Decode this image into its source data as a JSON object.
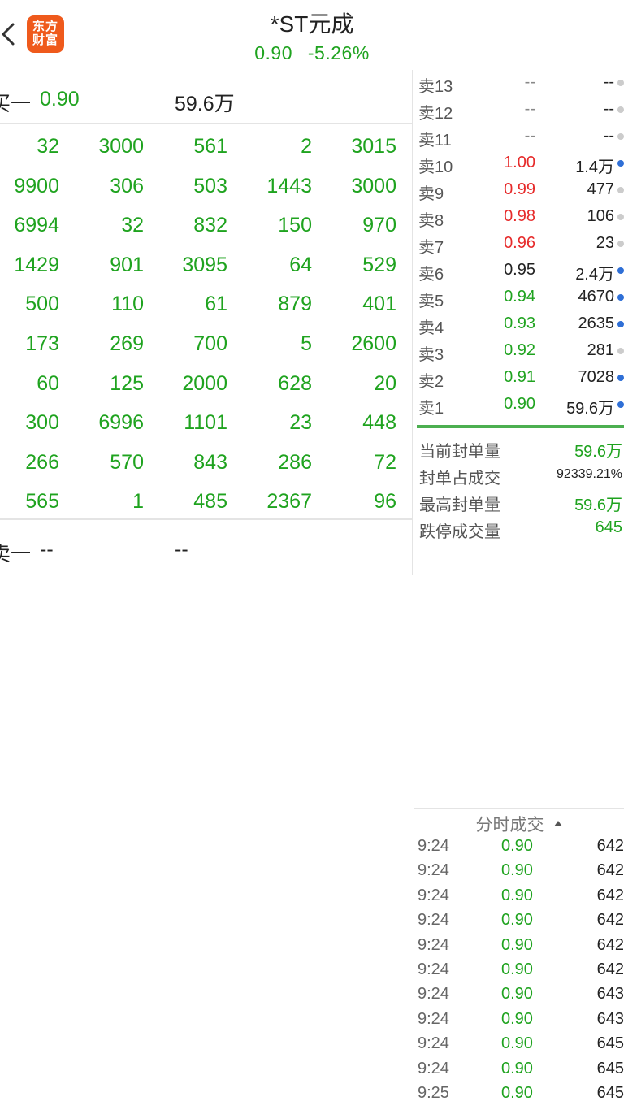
{
  "header": {
    "logo_text_line1": "东方",
    "logo_text_line2": "财富",
    "title": "*ST元成",
    "price": "0.90",
    "change": "-5.26%"
  },
  "left_panel": {
    "buy1": {
      "label": "买一",
      "price": "0.90",
      "volume": "59.6万"
    },
    "queue": [
      [
        "32",
        "3000",
        "561",
        "2",
        "3015"
      ],
      [
        "9900",
        "306",
        "503",
        "1443",
        "3000"
      ],
      [
        "6994",
        "32",
        "832",
        "150",
        "970"
      ],
      [
        "1429",
        "901",
        "3095",
        "64",
        "529"
      ],
      [
        "500",
        "110",
        "61",
        "879",
        "401"
      ],
      [
        "173",
        "269",
        "700",
        "5",
        "2600"
      ],
      [
        "60",
        "125",
        "2000",
        "628",
        "20"
      ],
      [
        "300",
        "6996",
        "1101",
        "23",
        "448"
      ],
      [
        "266",
        "570",
        "843",
        "286",
        "72"
      ],
      [
        "565",
        "1",
        "485",
        "2367",
        "96"
      ]
    ],
    "sell1": {
      "label": "卖一",
      "price": "--",
      "volume": "--"
    }
  },
  "order_book": [
    {
      "label": "卖13",
      "price": "--",
      "volume": "--",
      "price_color": "#888888",
      "dot": "#cccccc"
    },
    {
      "label": "卖12",
      "price": "--",
      "volume": "--",
      "price_color": "#888888",
      "dot": "#cccccc"
    },
    {
      "label": "卖11",
      "price": "--",
      "volume": "--",
      "price_color": "#888888",
      "dot": "#cccccc"
    },
    {
      "label": "卖10",
      "price": "1.00",
      "volume": "1.4万",
      "price_color": "#e62a2a",
      "dot": "#2f6fd6"
    },
    {
      "label": "卖9",
      "price": "0.99",
      "volume": "477",
      "price_color": "#e62a2a",
      "dot": "#cccccc"
    },
    {
      "label": "卖8",
      "price": "0.98",
      "volume": "106",
      "price_color": "#e62a2a",
      "dot": "#cccccc"
    },
    {
      "label": "卖7",
      "price": "0.96",
      "volume": "23",
      "price_color": "#e62a2a",
      "dot": "#cccccc"
    },
    {
      "label": "卖6",
      "price": "0.95",
      "volume": "2.4万",
      "price_color": "#222222",
      "dot": "#2f6fd6"
    },
    {
      "label": "卖5",
      "price": "0.94",
      "volume": "4670",
      "price_color": "#1fa31f",
      "dot": "#2f6fd6"
    },
    {
      "label": "卖4",
      "price": "0.93",
      "volume": "2635",
      "price_color": "#1fa31f",
      "dot": "#2f6fd6"
    },
    {
      "label": "卖3",
      "price": "0.92",
      "volume": "281",
      "price_color": "#1fa31f",
      "dot": "#cccccc"
    },
    {
      "label": "卖2",
      "price": "0.91",
      "volume": "7028",
      "price_color": "#1fa31f",
      "dot": "#2f6fd6"
    },
    {
      "label": "卖1",
      "price": "0.90",
      "volume": "59.6万",
      "price_color": "#1fa31f",
      "dot": "#2f6fd6"
    }
  ],
  "stats": [
    {
      "label": "当前封单量",
      "value": "59.6万"
    },
    {
      "label": "封单占成交",
      "value": "92339.21%"
    },
    {
      "label": "最高封单量",
      "value": "59.6万"
    },
    {
      "label": "跌停成交量",
      "value": "645"
    }
  ],
  "ticks": {
    "title": "分时成交",
    "rows": [
      {
        "time": "9:24",
        "price": "0.90",
        "volume": "642"
      },
      {
        "time": "9:24",
        "price": "0.90",
        "volume": "642"
      },
      {
        "time": "9:24",
        "price": "0.90",
        "volume": "642"
      },
      {
        "time": "9:24",
        "price": "0.90",
        "volume": "642"
      },
      {
        "time": "9:24",
        "price": "0.90",
        "volume": "642"
      },
      {
        "time": "9:24",
        "price": "0.90",
        "volume": "642"
      },
      {
        "time": "9:24",
        "price": "0.90",
        "volume": "643"
      },
      {
        "time": "9:24",
        "price": "0.90",
        "volume": "643"
      },
      {
        "time": "9:24",
        "price": "0.90",
        "volume": "645"
      },
      {
        "time": "9:24",
        "price": "0.90",
        "volume": "645"
      },
      {
        "time": "9:25",
        "price": "0.90",
        "volume": "645"
      }
    ]
  }
}
